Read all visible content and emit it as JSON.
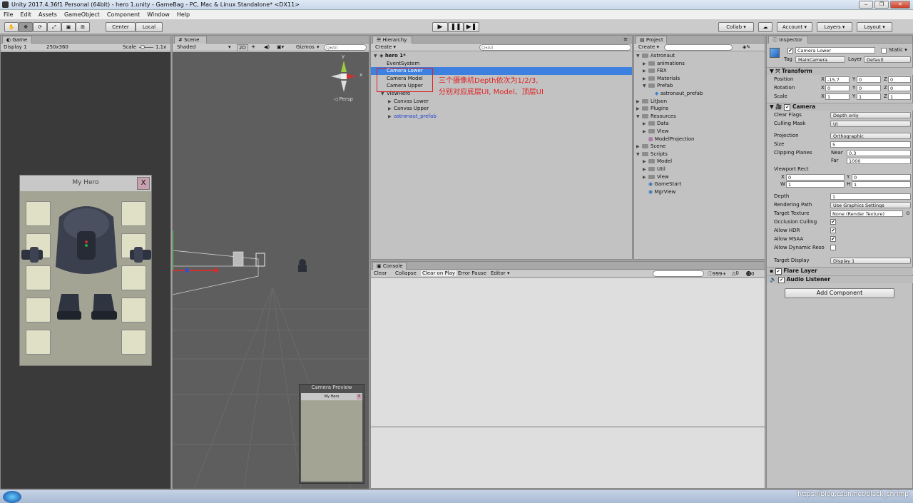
{
  "window": {
    "title": "Unity 2017.4.36f1 Personal (64bit) - hero 1.unity - GameBag - PC, Mac & Linux Standalone* <DX11>",
    "controls": [
      "‒",
      "❐",
      "✕"
    ]
  },
  "menu": [
    "File",
    "Edit",
    "Assets",
    "GameObject",
    "Component",
    "Window",
    "Help"
  ],
  "toolbar": {
    "tools": [
      "hand-icon",
      "move-icon",
      "rotate-icon",
      "scale-icon",
      "rect-icon",
      "transform-icon"
    ],
    "pivot": "Center",
    "space": "Local",
    "collab": "Collab ▾",
    "account": "Account",
    "layers": "Layers",
    "layout": "Layout"
  },
  "game": {
    "tab": "Game",
    "display": "Display 1",
    "resolution": "250x360",
    "scale_label": "Scale",
    "scale_value": "1.1x",
    "window_title": "My Hero",
    "close_label": "X"
  },
  "scene": {
    "tab": "Scene",
    "shaded": "Shaded",
    "mode2d": "2D",
    "gizmos": "Gizmos",
    "search_placeholder": "Q▾All",
    "persp": "◁ Persp",
    "axis_y": "y",
    "axis_x": "x",
    "preview_title": "Camera Preview",
    "preview_window": "My Hero"
  },
  "hierarchy": {
    "tab": "Hierarchy",
    "create": "Create ▾",
    "search_placeholder": "Q▾All",
    "root": "hero 1*",
    "items": [
      {
        "label": "EventSystem",
        "indent": 1,
        "selected": false,
        "prefab": false
      },
      {
        "label": "Camera Lower",
        "indent": 1,
        "selected": true,
        "prefab": false
      },
      {
        "label": "Camera Model",
        "indent": 1,
        "selected": false,
        "prefab": false
      },
      {
        "label": "Camera Upper",
        "indent": 1,
        "selected": false,
        "prefab": false
      },
      {
        "label": "ViewHero",
        "indent": 1,
        "selected": false,
        "prefab": false
      },
      {
        "label": "Canvas Lower",
        "indent": 2,
        "selected": false,
        "prefab": false
      },
      {
        "label": "Canvas Upper",
        "indent": 2,
        "selected": false,
        "prefab": false
      },
      {
        "label": "astronaut_prefab",
        "indent": 2,
        "selected": false,
        "prefab": true
      }
    ],
    "annotation_line1": "三个摄像机Depth依次为1/2/3,",
    "annotation_line2": "分别对应底层UI, Model、顶层UI"
  },
  "project": {
    "tab": "Project",
    "create": "Create ▾",
    "items": [
      {
        "label": "Astronaut",
        "indent": 0,
        "kind": "folder"
      },
      {
        "label": "animations",
        "indent": 1,
        "kind": "folder"
      },
      {
        "label": "FBX",
        "indent": 1,
        "kind": "folder"
      },
      {
        "label": "Materials",
        "indent": 1,
        "kind": "folder"
      },
      {
        "label": "Prefab",
        "indent": 1,
        "kind": "folder"
      },
      {
        "label": "astronaut_prefab",
        "indent": 2,
        "kind": "prefab"
      },
      {
        "label": "LitJson",
        "indent": 0,
        "kind": "folder"
      },
      {
        "label": "Plugins",
        "indent": 0,
        "kind": "folder"
      },
      {
        "label": "Resources",
        "indent": 0,
        "kind": "folder"
      },
      {
        "label": "Data",
        "indent": 1,
        "kind": "folder"
      },
      {
        "label": "View",
        "indent": 1,
        "kind": "folder"
      },
      {
        "label": "ModelProjection",
        "indent": 1,
        "kind": "asset"
      },
      {
        "label": "Scene",
        "indent": 0,
        "kind": "folder"
      },
      {
        "label": "Scripts",
        "indent": 0,
        "kind": "folder"
      },
      {
        "label": "Model",
        "indent": 1,
        "kind": "folder"
      },
      {
        "label": "Util",
        "indent": 1,
        "kind": "folder"
      },
      {
        "label": "View",
        "indent": 1,
        "kind": "folder"
      },
      {
        "label": "GameStart",
        "indent": 1,
        "kind": "script"
      },
      {
        "label": "MgrView",
        "indent": 1,
        "kind": "script"
      }
    ]
  },
  "console": {
    "tab": "Console",
    "buttons": [
      "Clear",
      "Collapse",
      "Clear on Play",
      "Error Pause",
      "Editor ▾"
    ],
    "count_logs": "999+",
    "count_warnings": "0",
    "count_errors": "0"
  },
  "inspector": {
    "tab": "Inspector",
    "object_name": "Camera Lower",
    "static_label": "Static ▾",
    "tag_label": "Tag",
    "tag_value": "MainCamera",
    "layer_label": "Layer",
    "layer_value": "Default",
    "transform": {
      "header": "Transform",
      "position_label": "Position",
      "rotation_label": "Rotation",
      "scale_label": "Scale",
      "pos": [
        "-15.7",
        "0",
        "0"
      ],
      "rot": [
        "0",
        "0",
        "0"
      ],
      "scale": [
        "1",
        "1",
        "1"
      ]
    },
    "camera": {
      "header": "Camera",
      "clear_flags_label": "Clear Flags",
      "clear_flags": "Depth only",
      "culling_mask_label": "Culling Mask",
      "culling_mask": "UI",
      "projection_label": "Projection",
      "projection": "Orthographic",
      "size_label": "Size",
      "size": "5",
      "clipping_label": "Clipping Planes",
      "near_label": "Near",
      "near": "0.3",
      "far_label": "Far",
      "far": "1000",
      "viewport_label": "Viewport Rect",
      "vx": "0",
      "vy": "0",
      "vw": "1",
      "vh": "1",
      "depth_label": "Depth",
      "depth": "1",
      "rendering_label": "Rendering Path",
      "rendering": "Use Graphics Settings",
      "target_label": "Target Texture",
      "target": "None (Render Texture)",
      "occlusion_label": "Occlusion Culling",
      "hdr_label": "Allow HDR",
      "msaa_label": "Allow MSAA",
      "dynres_label": "Allow Dynamic Reso",
      "display_label": "Target Display",
      "display": "Display 1"
    },
    "flare_header": "Flare Layer",
    "audio_header": "Audio Listener",
    "add_component": "Add Component"
  },
  "watermark": "https://blog.csdn.net/black_shrimp",
  "colors": {
    "selection": "#3d80df",
    "annotation": "#e02020",
    "scene_bg": "#5e5e5e"
  }
}
